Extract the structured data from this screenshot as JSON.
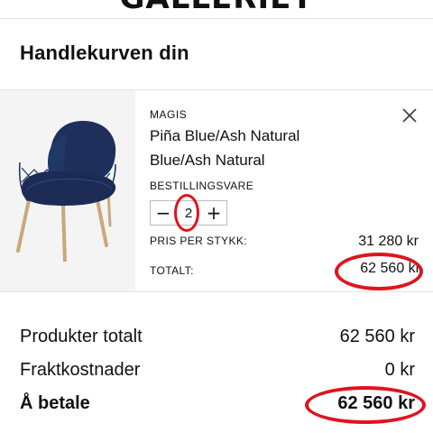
{
  "header": {
    "brand": "GALLERIET"
  },
  "cart": {
    "title": "Handlekurven din",
    "item": {
      "brand": "MAGIS",
      "name": "Piña Blue/Ash Natural",
      "variant": "Blue/Ash Natural",
      "order_type": "BESTILLINGSVARE",
      "quantity": "2",
      "decrement_symbol": "−",
      "increment_symbol": "+",
      "unit_price_label": "PRIS PER STYKK:",
      "unit_price": "31 280 kr",
      "total_label": "TOTALT:",
      "total": "62 560 kr",
      "remove_icon": "close-icon"
    }
  },
  "summary": {
    "products_total_label": "Produkter totalt",
    "products_total": "62 560 kr",
    "shipping_label": "Fraktkostnader",
    "shipping": "0 kr",
    "to_pay_label": "Å betale",
    "to_pay": "62 560 kr"
  },
  "colors": {
    "annotation": "#e0131c",
    "chair_fabric": "#1d2f5a",
    "chair_legs": "#c9a87a"
  }
}
